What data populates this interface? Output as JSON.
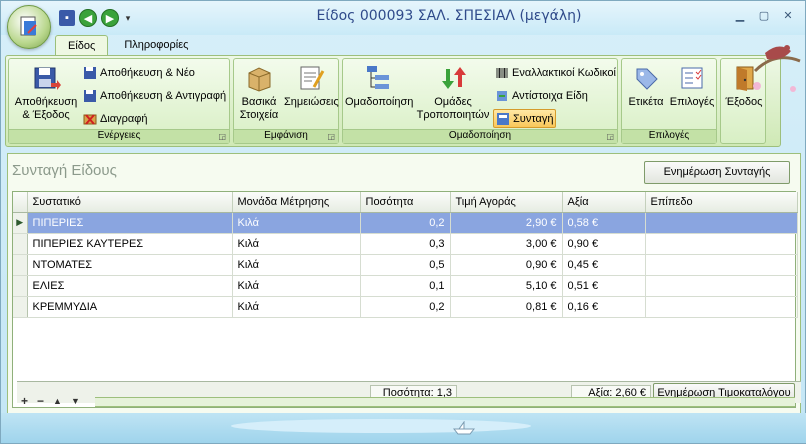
{
  "window": {
    "title": "Είδος 000093 ΣΑΛ. ΣΠΕΣΙΑΛ (μεγάλη)",
    "controls": [
      "minimize-icon",
      "maximize-icon",
      "close-icon"
    ]
  },
  "tabs": [
    {
      "label": "Είδος",
      "active": true
    },
    {
      "label": "Πληροφορίες",
      "active": false
    }
  ],
  "ribbon": {
    "groups": {
      "actions": {
        "title": "Ενέργειες",
        "save_exit": "Αποθήκευση & Έξοδος",
        "save_new": "Αποθήκευση & Νέο",
        "save_copy": "Αποθήκευση & Αντιγραφή",
        "delete": "Διαγραφή"
      },
      "view": {
        "title": "Εμφάνιση",
        "basic": "Βασικά Στοιχεία",
        "notes": "Σημειώσεις"
      },
      "grouping": {
        "title": "Ομαδοποίηση",
        "grouping": "Ομαδοποίηση",
        "modifier_groups": "Ομάδες Τροποποιητών",
        "alt_codes": "Εναλλακτικοί Κωδικοί",
        "matching": "Αντίστοιχα Είδη",
        "recipe": "Συνταγή"
      },
      "options": {
        "title": "Επιλογές",
        "label": "Ετικέτα",
        "options": "Επιλογές"
      },
      "exit": {
        "label": "Έξοδος"
      }
    }
  },
  "panel": {
    "title": "Συνταγή Είδους",
    "update_recipe": "Ενημέρωση Συνταγής",
    "update_pricelist": "Ενημέρωση Τιμοκαταλόγου"
  },
  "table": {
    "columns": [
      "Συστατικό",
      "Μονάδα Μέτρησης",
      "Ποσότητα",
      "Τιμή Αγοράς",
      "Αξία",
      "Επίπεδο"
    ],
    "rows": [
      {
        "item": "ΠΙΠΕΡΙΕΣ",
        "unit": "Κιλά",
        "qty": "0,2",
        "price": "2,90 €",
        "value": "0,58 €",
        "level": "",
        "selected": true
      },
      {
        "item": "ΠΙΠΕΡΙΕΣ ΚΑΥΤΕΡΕΣ",
        "unit": "Κιλά",
        "qty": "0,3",
        "price": "3,00 €",
        "value": "0,90 €",
        "level": ""
      },
      {
        "item": "ΝΤΟΜΑΤΕΣ",
        "unit": "Κιλά",
        "qty": "0,5",
        "price": "0,90 €",
        "value": "0,45 €",
        "level": ""
      },
      {
        "item": "ΕΛΙΕΣ",
        "unit": "Κιλά",
        "qty": "0,1",
        "price": "5,10 €",
        "value": "0,51 €",
        "level": ""
      },
      {
        "item": "ΚΡΕΜΜΥΔΙΑ",
        "unit": "Κιλά",
        "qty": "0,2",
        "price": "0,81 €",
        "value": "0,16 €",
        "level": ""
      }
    ],
    "footer": {
      "qty_total": "Ποσότητα: 1,3",
      "value_total": "Αξία: 2,60 €"
    }
  },
  "navigator": [
    "+",
    "−",
    "▲",
    "▼"
  ]
}
